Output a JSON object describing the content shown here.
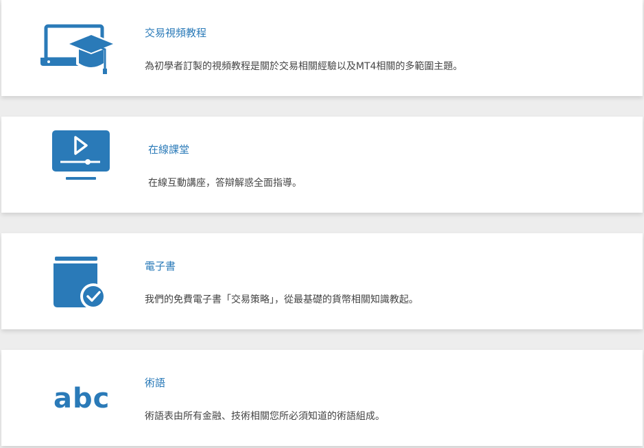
{
  "colors": {
    "accent": "#2a7ab8",
    "text": "#444444",
    "card": "#ffffff",
    "background": "#ededed"
  },
  "cards": [
    {
      "icon": "laptop-graduation-cap-icon",
      "title": "交易視頻教程",
      "description": "為初學者訂製的視頻教程是關於交易相關經驗以及MT4相關的多範圍主題。"
    },
    {
      "icon": "monitor-play-icon",
      "title": "在線課堂",
      "description": "在線互動講座，答辯解惑全面指導。"
    },
    {
      "icon": "ebook-checkmark-icon",
      "title": "電子書",
      "description": "我們的免費電子書「交易策略」，從最基礎的貨幣相關知識教起。"
    },
    {
      "icon": "abc-glossary-icon",
      "icon_text": "abc",
      "title": "術語",
      "description": "術語表由所有金融、技術相關您所必須知道的術語組成。"
    }
  ]
}
